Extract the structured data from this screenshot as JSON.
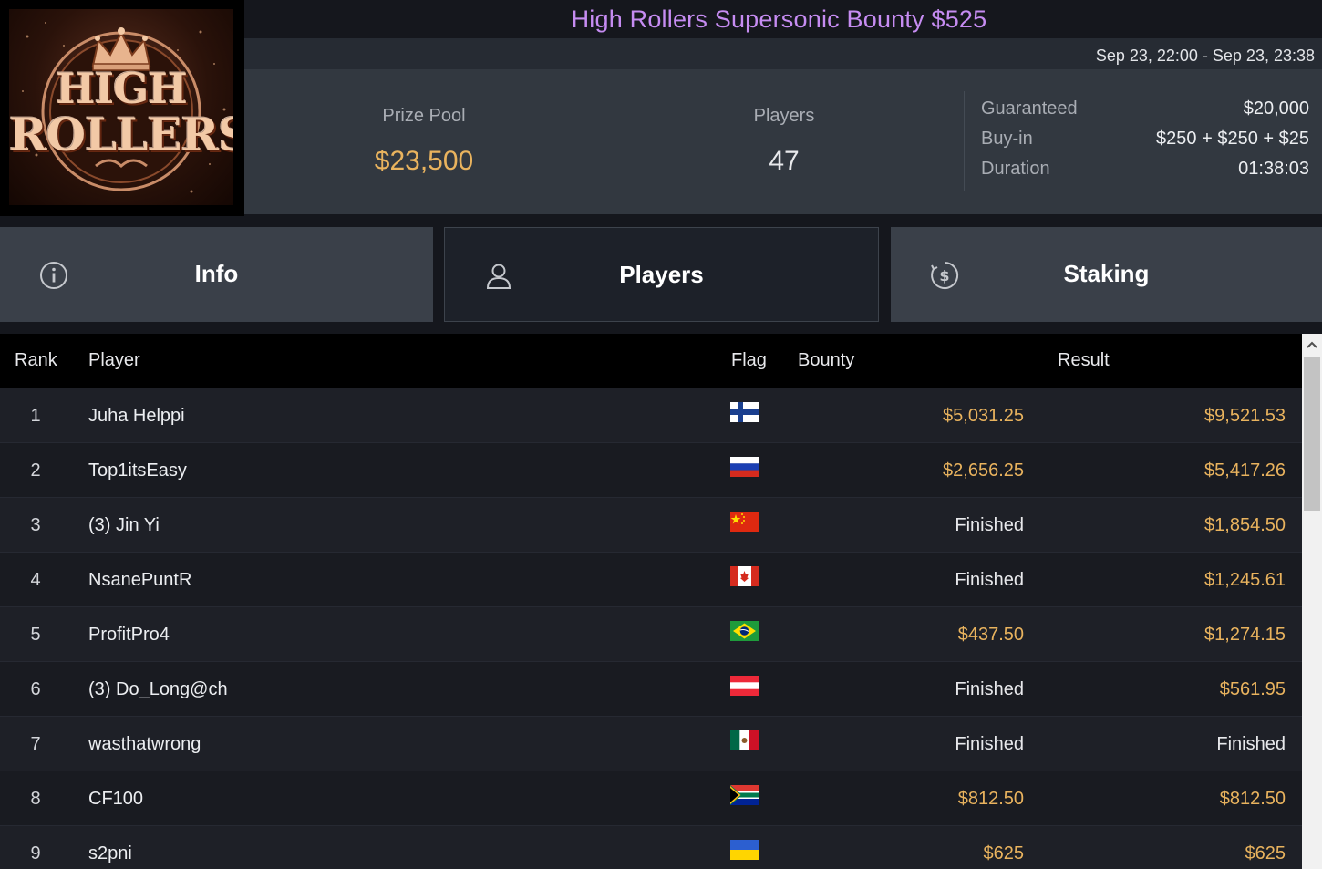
{
  "logo": {
    "line1": "HIGH",
    "line2": "ROLLERS"
  },
  "header": {
    "title": "High Rollers Supersonic Bounty $525",
    "dates": "Sep 23, 22:00 - Sep 23, 23:38"
  },
  "stats": {
    "prize_pool_label": "Prize Pool",
    "prize_pool_value": "$23,500",
    "players_label": "Players",
    "players_value": "47",
    "details": [
      {
        "label": "Guaranteed",
        "value": "$20,000"
      },
      {
        "label": "Buy-in",
        "value": "$250 + $250 + $25"
      },
      {
        "label": "Duration",
        "value": "01:38:03"
      }
    ]
  },
  "tabs": [
    {
      "label": "Info",
      "icon": "info-icon",
      "active": false
    },
    {
      "label": "Players",
      "icon": "user-icon",
      "active": true
    },
    {
      "label": "Staking",
      "icon": "dollar-coin-icon",
      "active": false
    }
  ],
  "table": {
    "headers": {
      "rank": "Rank",
      "player": "Player",
      "flag": "Flag",
      "bounty": "Bounty",
      "result": "Result"
    },
    "rows": [
      {
        "rank": "1",
        "player": "Juha Helppi",
        "flag": "FI",
        "bounty": "$5,031.25",
        "result": "$9,521.53"
      },
      {
        "rank": "2",
        "player": "Top1itsEasy",
        "flag": "RU",
        "bounty": "$2,656.25",
        "result": "$5,417.26"
      },
      {
        "rank": "3",
        "player": "(3) Jin Yi",
        "flag": "CN",
        "bounty": "Finished",
        "result": "$1,854.50"
      },
      {
        "rank": "4",
        "player": "NsanePuntR",
        "flag": "CA",
        "bounty": "Finished",
        "result": "$1,245.61"
      },
      {
        "rank": "5",
        "player": "ProfitPro4",
        "flag": "BR",
        "bounty": "$437.50",
        "result": "$1,274.15"
      },
      {
        "rank": "6",
        "player": "(3) Do_Long@ch",
        "flag": "AT",
        "bounty": "Finished",
        "result": "$561.95"
      },
      {
        "rank": "7",
        "player": "wasthatwrong",
        "flag": "MX",
        "bounty": "Finished",
        "result": "Finished"
      },
      {
        "rank": "8",
        "player": "CF100",
        "flag": "ZA",
        "bounty": "$812.50",
        "result": "$812.50"
      },
      {
        "rank": "9",
        "player": "s2pni",
        "flag": "UA",
        "bounty": "$625",
        "result": "$625"
      }
    ]
  },
  "colors": {
    "title": "#c68cf2",
    "money": "#e9b35e",
    "panel": "#323840",
    "tab": "#3a4049",
    "tab_active": "#1d2129"
  }
}
